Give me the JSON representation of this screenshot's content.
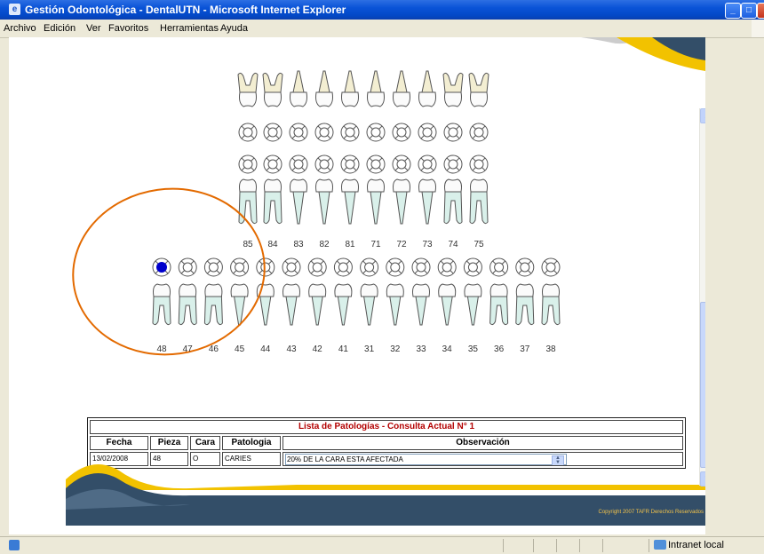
{
  "window": {
    "title": "Gestión Odontológica - DentalUTN - Microsoft Internet Explorer"
  },
  "menu": [
    {
      "label": "Archivo"
    },
    {
      "label": "Edición"
    },
    {
      "label": "Ver"
    },
    {
      "label": "Favoritos"
    },
    {
      "label": "Herramientas"
    },
    {
      "label": "Ayuda"
    }
  ],
  "odontogram": {
    "deciduous_lower": [
      "85",
      "84",
      "83",
      "82",
      "81",
      "71",
      "72",
      "73",
      "74",
      "75"
    ],
    "permanent_lower": [
      "48",
      "47",
      "46",
      "45",
      "44",
      "43",
      "42",
      "41",
      "31",
      "32",
      "33",
      "34",
      "35",
      "36",
      "37",
      "38"
    ],
    "selected_tooth": "48",
    "marker_color": "#0000cc",
    "annotation_color": "#e36a00"
  },
  "pathology_table": {
    "title": "Lista de Patologías - Consulta Actual N° 1",
    "headers": {
      "fecha": "Fecha",
      "pieza": "Pieza",
      "cara": "Cara",
      "patologia": "Patologia",
      "observacion": "Observación"
    },
    "rows": [
      {
        "fecha": "13/02/2008",
        "pieza": "48",
        "cara": "O",
        "patologia": "CARIES",
        "observacion": "20% DE LA CARA ESTA AFECTADA"
      }
    ]
  },
  "footer": {
    "copyright": "Copyright 2007 TAFR Derechos Reservados"
  },
  "status": {
    "zone": "Intranet local"
  },
  "colors": {
    "title_bar": "#0a53d7",
    "table_title": "#b30000",
    "footer_band": "#334e68",
    "footer_swoosh": "#f2c200"
  }
}
